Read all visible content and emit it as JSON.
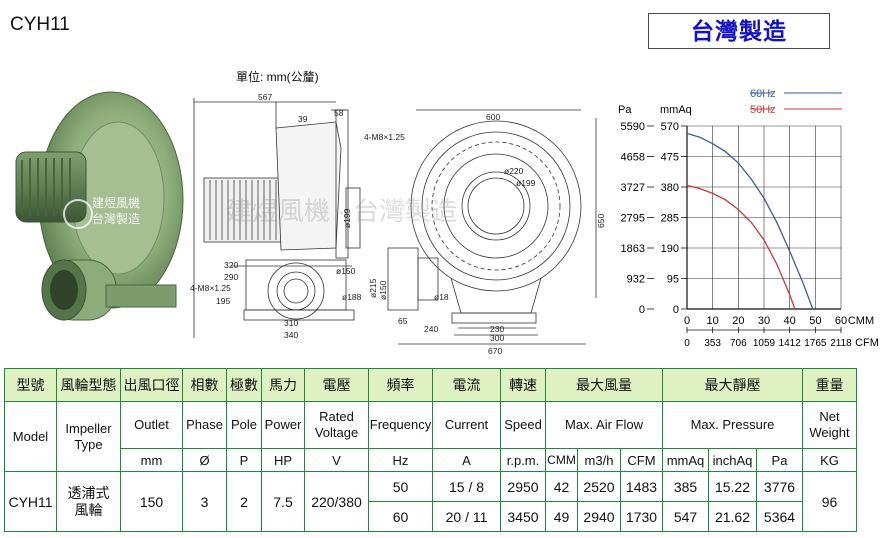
{
  "header": {
    "model": "CYH11",
    "badge": "台灣製造"
  },
  "drawing": {
    "unit_label": "單位: mm(公釐)",
    "watermarks": [
      "建煜風機",
      "台灣製造",
      "建煜風機 · 台灣製造"
    ],
    "side_dims": [
      "567",
      "39",
      "58",
      "ø199",
      "320",
      "290",
      "4-M8×1.25",
      "195",
      "ø150",
      "ø188",
      "310",
      "340"
    ],
    "front_dims": [
      "600",
      "4-M8×1.25",
      "ø220",
      "ø199",
      "650",
      "ø215",
      "ø150",
      "ø18",
      "65",
      "240",
      "230",
      "300",
      "670"
    ]
  },
  "chart_data": {
    "type": "line",
    "legend": [
      "60Hz",
      "50Hz"
    ],
    "colors": {
      "60Hz": "#3a5d9c",
      "50Hz": "#c83a3a"
    },
    "y_left_unit": "Pa",
    "y_right_unit": "mmAq",
    "y_pa_ticks": [
      "5590",
      "4658",
      "3727",
      "2795",
      "1863",
      "932",
      "0"
    ],
    "y_mmaq_ticks": [
      "570",
      "475",
      "380",
      "285",
      "190",
      "95",
      "0"
    ],
    "x_cmm_ticks": [
      "0",
      "10",
      "20",
      "30",
      "40",
      "50",
      "60"
    ],
    "x_cmm_unit": "CMM",
    "x_cfm_ticks": [
      "0",
      "353",
      "706",
      "1059",
      "1412",
      "1765",
      "2118"
    ],
    "x_cfm_unit": "CFM",
    "xlim": [
      0,
      60
    ],
    "ylim": [
      0,
      570
    ],
    "series": [
      {
        "name": "60Hz",
        "x": [
          0,
          5,
          10,
          15,
          20,
          25,
          30,
          35,
          40,
          45,
          49
        ],
        "y": [
          547,
          535,
          515,
          490,
          455,
          405,
          345,
          270,
          180,
          85,
          0
        ]
      },
      {
        "name": "50Hz",
        "x": [
          0,
          5,
          10,
          15,
          20,
          25,
          30,
          35,
          40,
          42
        ],
        "y": [
          385,
          375,
          360,
          340,
          310,
          270,
          215,
          140,
          45,
          0
        ]
      }
    ],
    "grid": true
  },
  "table": {
    "zh_headers": [
      "型號",
      "風輪型態",
      "出風口徑",
      "相數",
      "極數",
      "馬力",
      "電壓",
      "頻率",
      "電流",
      "轉速",
      "最大風量",
      "最大靜壓",
      "重量"
    ],
    "en_headers": [
      "Model",
      "Impeller Type",
      "Outlet",
      "Phase",
      "Pole",
      "Power",
      "Rated Voltage",
      "Frequency",
      "Current",
      "Speed",
      "Max. Air Flow",
      "Max. Pressure",
      "Net Weight"
    ],
    "units": [
      "mm",
      "Ø",
      "P",
      "HP",
      "V",
      "Hz",
      "A",
      "r.p.m.",
      "CMM",
      "m3/h",
      "CFM",
      "mmAq",
      "inchAq",
      "Pa",
      "KG"
    ],
    "model": "CYH11",
    "impeller": "透浦式 風輪",
    "outlet": "150",
    "phase": "3",
    "pole": "2",
    "power": "7.5",
    "voltage": "220/380",
    "weight": "96",
    "rows": [
      {
        "hz": "50",
        "current": "15 / 8",
        "speed": "2950",
        "cmm": "42",
        "m3h": "2520",
        "cfm": "1483",
        "mmaq": "385",
        "inchaq": "15.22",
        "pa": "3776"
      },
      {
        "hz": "60",
        "current": "20 / 11",
        "speed": "3450",
        "cmm": "49",
        "m3h": "2940",
        "cfm": "1730",
        "mmaq": "547",
        "inchaq": "21.62",
        "pa": "5364"
      }
    ]
  }
}
